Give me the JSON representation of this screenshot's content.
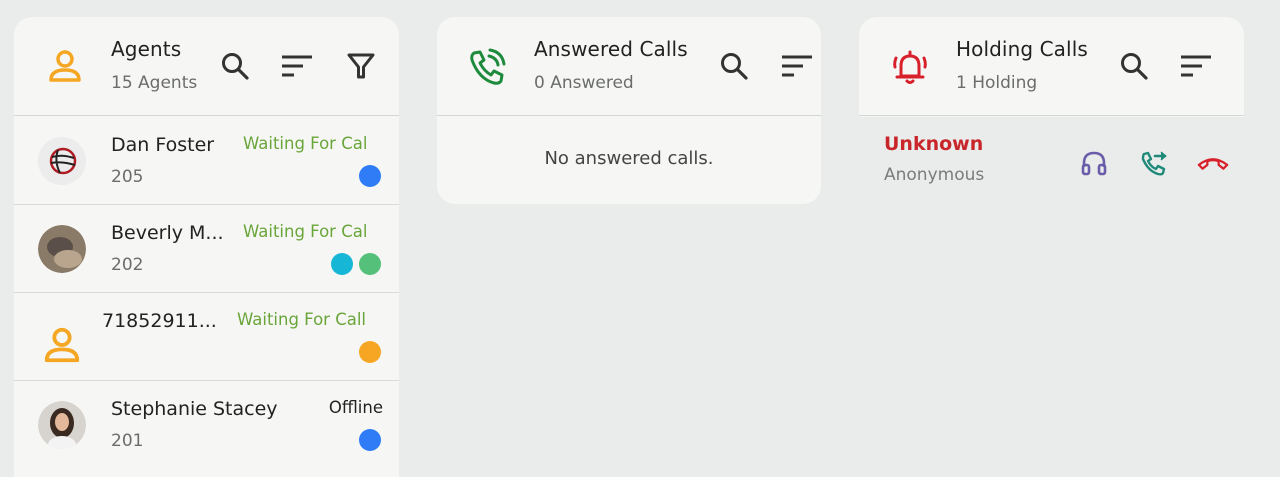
{
  "agents_panel": {
    "title": "Agents",
    "subtitle": "15 Agents",
    "icons": [
      "person-icon",
      "search-icon",
      "sort-icon",
      "filter-icon"
    ],
    "agents": [
      {
        "name": "Dan Foster",
        "ext": "205",
        "status": "Waiting For Cal",
        "dots": [
          "#2f7cf6"
        ]
      },
      {
        "name": "Beverly M...",
        "ext": "202",
        "status": "Waiting For Cal",
        "dots": [
          "#16b6d6",
          "#55c07a"
        ]
      },
      {
        "name": "71852911...",
        "ext": "",
        "status": "Waiting For Call",
        "dots": [
          "#f6a623"
        ]
      },
      {
        "name": "Stephanie Stacey",
        "ext": "201",
        "status": "Offline",
        "dots": [
          "#2f7cf6"
        ]
      }
    ]
  },
  "answered_panel": {
    "title": "Answered Calls",
    "subtitle": "0 Answered",
    "empty_message": "No answered calls."
  },
  "holding_panel": {
    "title": "Holding Calls",
    "subtitle": "1 Holding",
    "calls": [
      {
        "name": "Unknown",
        "sub": "Anonymous"
      }
    ]
  },
  "colors": {
    "agent_accent": "#f5a623",
    "answered_accent": "#1e8a3c",
    "holding_accent": "#d8202b",
    "waiting_status": "#6aa53a"
  }
}
